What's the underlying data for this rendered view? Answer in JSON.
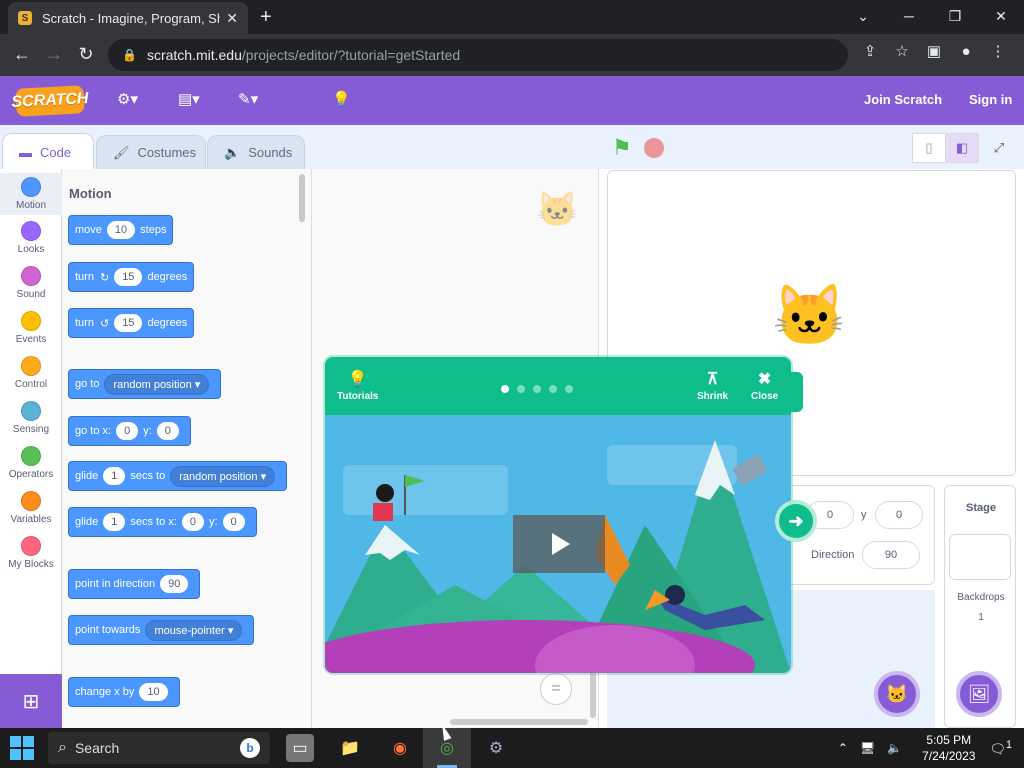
{
  "browser": {
    "tab_title": "Scratch - Imagine, Program, Share",
    "url_host": "scratch.mit.edu",
    "url_path": "/projects/editor/?tutorial=getStarted"
  },
  "menu": {
    "logo": "SCRATCH",
    "join": "Join Scratch",
    "signin": "Sign in"
  },
  "tabs": [
    {
      "label": "Code"
    },
    {
      "label": "Costumes"
    },
    {
      "label": "Sounds"
    }
  ],
  "categories": [
    {
      "label": "Motion",
      "color": "#4c97ff"
    },
    {
      "label": "Looks",
      "color": "#9966ff"
    },
    {
      "label": "Sound",
      "color": "#cf63cf"
    },
    {
      "label": "Events",
      "color": "#ffbf00"
    },
    {
      "label": "Control",
      "color": "#ffab19"
    },
    {
      "label": "Sensing",
      "color": "#5cb1d6"
    },
    {
      "label": "Operators",
      "color": "#59c059"
    },
    {
      "label": "Variables",
      "color": "#ff8c1a"
    },
    {
      "label": "My Blocks",
      "color": "#ff6680"
    }
  ],
  "palette": {
    "title": "Motion",
    "move": {
      "a": "move",
      "v": "10",
      "b": "steps"
    },
    "turn_right": {
      "a": "turn",
      "v": "15",
      "b": "degrees"
    },
    "turn_left": {
      "a": "turn",
      "v": "15",
      "b": "degrees"
    },
    "goto": {
      "a": "go to",
      "d": "random position"
    },
    "goto_xy": {
      "a": "go to x:",
      "x": "0",
      "yl": "y:",
      "y": "0"
    },
    "glide": {
      "a": "glide",
      "v": "1",
      "b": "secs to",
      "d": "random position"
    },
    "glide_xy": {
      "a": "glide",
      "v": "1",
      "b": "secs to x:",
      "x": "0",
      "yl": "y:",
      "y": "0"
    },
    "point_dir": {
      "a": "point in direction",
      "v": "90"
    },
    "point_towards": {
      "a": "point towards",
      "d": "mouse-pointer"
    },
    "change_x": {
      "a": "change x by",
      "v": "10"
    }
  },
  "tutorial": {
    "tutorials": "Tutorials",
    "shrink": "Shrink",
    "close": "Close",
    "dots": 5,
    "active_dot": 1
  },
  "sprite": {
    "x": "0",
    "y_label": "y",
    "y": "0",
    "direction_label": "Direction",
    "direction": "90"
  },
  "stage_pane": {
    "title": "Stage",
    "backdrops_label": "Backdrops",
    "backdrops_count": "1"
  },
  "taskbar": {
    "search": "Search",
    "time": "5:05 PM",
    "date": "7/24/2023",
    "notif": "1"
  }
}
